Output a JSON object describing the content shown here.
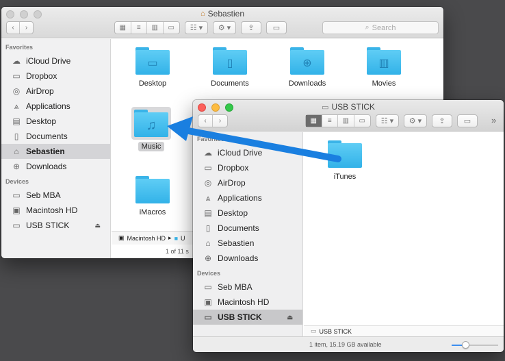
{
  "window_back": {
    "title": "Sebastien",
    "search_placeholder": "Search",
    "favorites_header": "Favorites",
    "favorites": [
      {
        "label": "iCloud Drive",
        "icon": "cloud-icon"
      },
      {
        "label": "Dropbox",
        "icon": "folder-icon"
      },
      {
        "label": "AirDrop",
        "icon": "airdrop-icon"
      },
      {
        "label": "Applications",
        "icon": "applications-icon"
      },
      {
        "label": "Desktop",
        "icon": "desktop-icon"
      },
      {
        "label": "Documents",
        "icon": "documents-icon"
      },
      {
        "label": "Sebastien",
        "icon": "home-icon",
        "selected": true
      },
      {
        "label": "Downloads",
        "icon": "downloads-icon"
      }
    ],
    "devices_header": "Devices",
    "devices": [
      {
        "label": "Seb MBA",
        "icon": "laptop-icon"
      },
      {
        "label": "Macintosh HD",
        "icon": "harddrive-icon"
      },
      {
        "label": "USB STICK",
        "icon": "usb-drive-icon",
        "eject": "⏏"
      }
    ],
    "folders": [
      "Desktop",
      "Documents",
      "Downloads",
      "Movies",
      "Music",
      "iMacros"
    ],
    "path": [
      "Macintosh HD",
      "▸",
      "U"
    ],
    "status": "1 of 11 s"
  },
  "window_front": {
    "title": "USB STICK",
    "overflow": "»",
    "favorites_header": "Favorites",
    "favorites": [
      {
        "label": "iCloud Drive",
        "icon": "cloud-icon"
      },
      {
        "label": "Dropbox",
        "icon": "folder-icon"
      },
      {
        "label": "AirDrop",
        "icon": "airdrop-icon"
      },
      {
        "label": "Applications",
        "icon": "applications-icon"
      },
      {
        "label": "Desktop",
        "icon": "desktop-icon"
      },
      {
        "label": "Documents",
        "icon": "documents-icon"
      },
      {
        "label": "Sebastien",
        "icon": "home-icon"
      },
      {
        "label": "Downloads",
        "icon": "downloads-icon"
      }
    ],
    "devices_header": "Devices",
    "devices": [
      {
        "label": "Seb MBA",
        "icon": "laptop-icon"
      },
      {
        "label": "Macintosh HD",
        "icon": "harddrive-icon"
      },
      {
        "label": "USB STICK",
        "icon": "usb-drive-icon",
        "eject": "⏏",
        "selected": true
      }
    ],
    "folders": [
      "iTunes"
    ],
    "path": [
      "USB STICK"
    ],
    "status": "1 item, 15.19 GB available",
    "icon_size_level": 0.3
  },
  "colors": {
    "folder_blue": "#3ab4e8",
    "drag_arrow": "#1a7fe0"
  }
}
